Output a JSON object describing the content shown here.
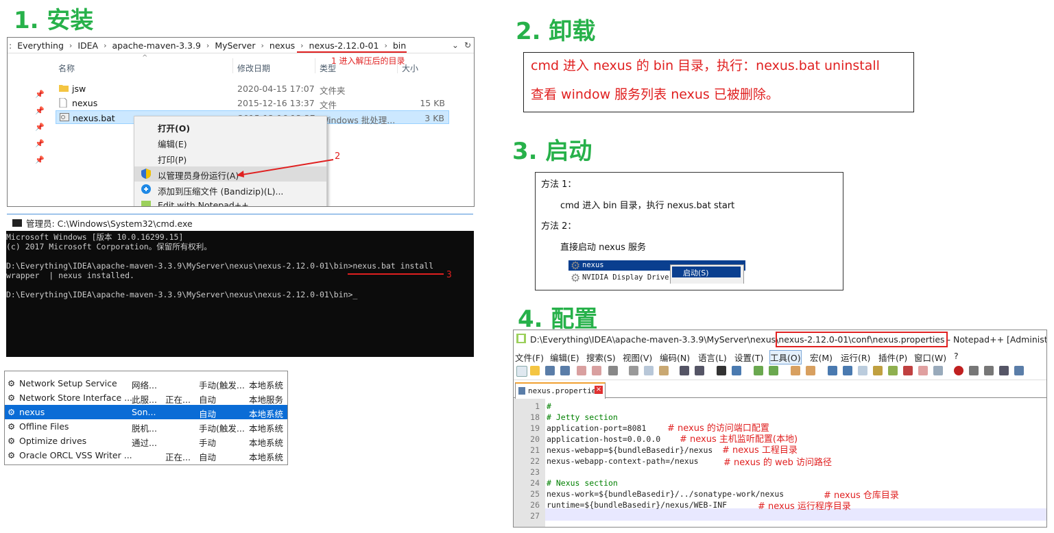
{
  "titles": {
    "install": "1. 安装",
    "uninstall": "2. 卸载",
    "start": "3. 启动",
    "config": "4. 配置"
  },
  "explorer": {
    "breadcrumbs": [
      "Everything",
      "IDEA",
      "apache-maven-3.3.9",
      "MyServer",
      "nexus",
      "nexus-2.12.0-01",
      "bin"
    ],
    "annotation1": "1 进入解压后的目录",
    "columns": {
      "name": "名称",
      "date": "修改日期",
      "type": "类型",
      "size": "大小"
    },
    "files": [
      {
        "name": "jsw",
        "date": "2020-04-15 17:07",
        "type": "文件夹",
        "size": "",
        "icon": "folder-icon"
      },
      {
        "name": "nexus",
        "date": "2015-12-16 13:37",
        "type": "文件",
        "size": "15 KB",
        "icon": "file-icon"
      },
      {
        "name": "nexus.bat",
        "date": "2015-12-16 13:37",
        "type": "Windows 批处理...",
        "size": "3 KB",
        "icon": "bat-file-icon"
      }
    ],
    "context_menu": [
      "打开(O)",
      "编辑(E)",
      "打印(P)",
      "以管理员身份运行(A)",
      "添加到压缩文件 (Bandizip)(L)...",
      "Edit with Notepad++"
    ],
    "annotation2": "2"
  },
  "cmd": {
    "title": "管理员: C:\\Windows\\System32\\cmd.exe",
    "lines": [
      "Microsoft Windows [版本 10.0.16299.15]",
      "(c) 2017 Microsoft Corporation。保留所有权利。",
      "",
      "D:\\Everything\\IDEA\\apache-maven-3.3.9\\MyServer\\nexus\\nexus-2.12.0-01\\bin>nexus.bat install",
      "wrapper  | nexus installed.",
      "",
      "D:\\Everything\\IDEA\\apache-maven-3.3.9\\MyServer\\nexus\\nexus-2.12.0-01\\bin>_"
    ],
    "annotation3": "3"
  },
  "services": [
    {
      "name": "Network Setup Service",
      "desc": "网络...",
      "status": "",
      "startup": "手动(触发...",
      "logon": "本地系统"
    },
    {
      "name": "Network Store Interface ...",
      "desc": "此服...",
      "status": "正在...",
      "startup": "自动",
      "logon": "本地服务"
    },
    {
      "name": "nexus",
      "desc": "Son...",
      "status": "",
      "startup": "自动",
      "logon": "本地系统"
    },
    {
      "name": "Offline Files",
      "desc": "脱机...",
      "status": "",
      "startup": "手动(触发...",
      "logon": "本地系统"
    },
    {
      "name": "Optimize drives",
      "desc": "通过...",
      "status": "",
      "startup": "手动",
      "logon": "本地系统"
    },
    {
      "name": "Oracle ORCL VSS Writer ...",
      "desc": "",
      "status": "正在...",
      "startup": "自动",
      "logon": "本地系统"
    }
  ],
  "uninstall": {
    "line1": "cmd 进入 nexus 的 bin 目录，执行：nexus.bat uninstall",
    "line2": "查看 window 服务列表 nexus 已被删除。"
  },
  "start": {
    "m1": "方法 1：",
    "m1_text": "cmd 进入 bin 目录，执行 nexus.bat start",
    "m2": "方法 2：",
    "m2_text": "直接启动 nexus 服务",
    "svc1": "nexus",
    "svc2": "NVIDIA Display Driver",
    "menu_item": "启动(S)"
  },
  "notepad": {
    "title_prefix": "D:\\Everything\\IDEA\\apache-maven-3.3.9\\MyServer\\nexus\\",
    "title_highlight": "nexus-2.12.0-01\\conf\\nexus.properties",
    "title_suffix": " - Notepad++ [Administrator]",
    "menu": [
      "文件(F)",
      "编辑(E)",
      "搜索(S)",
      "视图(V)",
      "编码(N)",
      "语言(L)",
      "设置(T)",
      "工具(O)",
      "宏(M)",
      "运行(R)",
      "插件(P)",
      "窗口(W)",
      "?"
    ],
    "tab": "nexus.properties",
    "lines": [
      {
        "no": "1",
        "code": "#",
        "comment": true,
        "note": ""
      },
      {
        "no": "18",
        "code": "# Jetty section",
        "comment": true,
        "note": ""
      },
      {
        "no": "19",
        "code": "application-port=8081",
        "comment": false,
        "note": "# nexus 的访问端口配置"
      },
      {
        "no": "20",
        "code": "application-host=0.0.0.0",
        "comment": false,
        "note": "# nexus 主机监听配置(本地)"
      },
      {
        "no": "21",
        "code": "nexus-webapp=${bundleBasedir}/nexus",
        "comment": false,
        "note": "# nexus 工程目录"
      },
      {
        "no": "22",
        "code": "nexus-webapp-context-path=/nexus",
        "comment": false,
        "note": "# nexus 的 web 访问路径"
      },
      {
        "no": "23",
        "code": "",
        "comment": false,
        "note": ""
      },
      {
        "no": "24",
        "code": "# Nexus section",
        "comment": true,
        "note": ""
      },
      {
        "no": "25",
        "code": "nexus-work=${bundleBasedir}/../sonatype-work/nexus",
        "comment": false,
        "note": "# nexus 仓库目录"
      },
      {
        "no": "26",
        "code": "runtime=${bundleBasedir}/nexus/WEB-INF",
        "comment": false,
        "note": "# nexus 运行程序目录"
      },
      {
        "no": "27",
        "code": "",
        "comment": false,
        "note": ""
      }
    ]
  }
}
